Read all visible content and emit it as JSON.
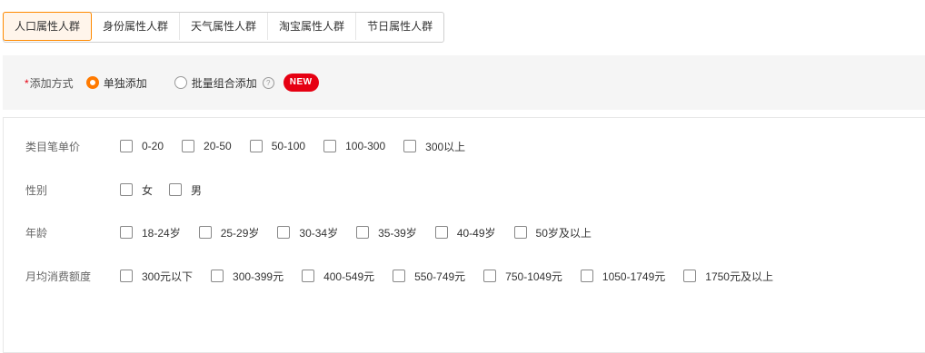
{
  "tabs": [
    {
      "label": "人口属性人群",
      "active": true
    },
    {
      "label": "身份属性人群",
      "active": false
    },
    {
      "label": "天气属性人群",
      "active": false
    },
    {
      "label": "淘宝属性人群",
      "active": false
    },
    {
      "label": "节日属性人群",
      "active": false
    }
  ],
  "method": {
    "required_mark": "*",
    "label": "添加方式",
    "options": [
      {
        "label": "单独添加",
        "checked": true
      },
      {
        "label": "批量组合添加",
        "checked": false
      }
    ],
    "help_icon": "?",
    "new_badge": "NEW"
  },
  "filters": [
    {
      "label": "类目笔单价",
      "options": [
        "0-20",
        "20-50",
        "50-100",
        "100-300",
        "300以上"
      ]
    },
    {
      "label": "性别",
      "options": [
        "女",
        "男"
      ]
    },
    {
      "label": "年龄",
      "options": [
        "18-24岁",
        "25-29岁",
        "30-34岁",
        "35-39岁",
        "40-49岁",
        "50岁及以上"
      ]
    },
    {
      "label": "月均消费额度",
      "options": [
        "300元以下",
        "300-399元",
        "400-549元",
        "550-749元",
        "750-1049元",
        "1050-1749元",
        "1750元及以上"
      ]
    }
  ],
  "colors": {
    "accent": "#ff7a00",
    "badge": "#e60012",
    "bar_bg": "#f5f5f5"
  }
}
